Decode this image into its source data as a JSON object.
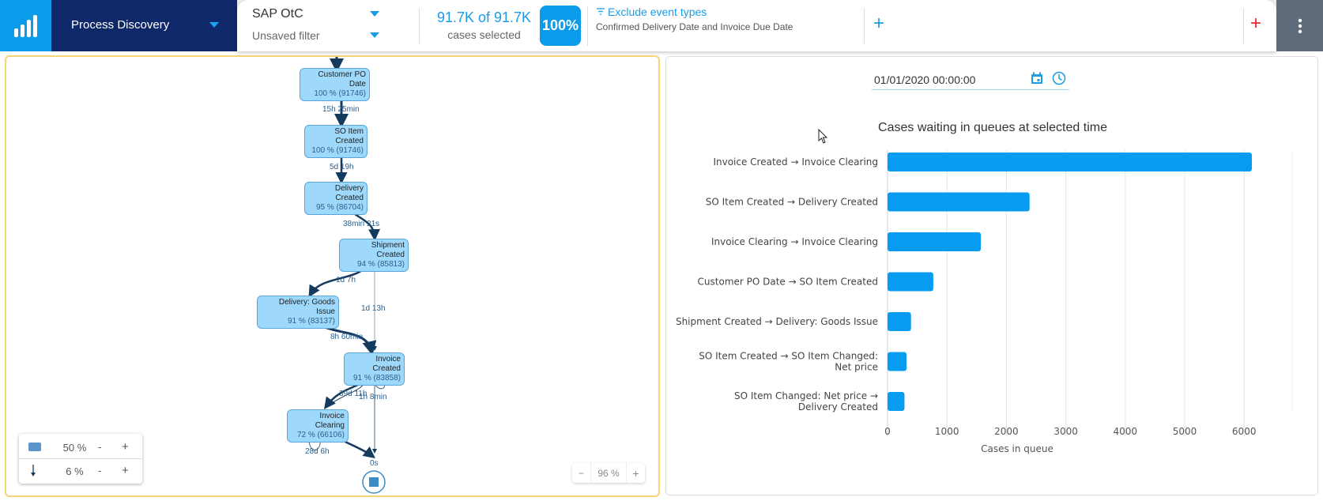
{
  "header": {
    "app_title": "Process Discovery",
    "dataset": "SAP OtC",
    "filter": "Unsaved filter",
    "cases_count": "91.7K of 91.7K",
    "cases_label": "cases selected",
    "cases_pct": "100%",
    "exclude_title": "Exclude event types",
    "exclude_desc": "Confirmed Delivery Date and Invoice Due Date",
    "add_filter": "+",
    "add_filter_red": "+",
    "menu_icon": "kebab-menu-icon"
  },
  "process_map": {
    "nodes": [
      {
        "name": "Customer PO Date",
        "stat": "100 % (91746)"
      },
      {
        "name": "SO Item Created",
        "stat": "100 % (91746)"
      },
      {
        "name": "Delivery Created",
        "stat": "95 % (86704)"
      },
      {
        "name": "Shipment Created",
        "stat": "94 % (85813)"
      },
      {
        "name": "Delivery: Goods Issue",
        "stat": "91 % (83137)"
      },
      {
        "name": "Invoice Created",
        "stat": "91 % (83858)"
      },
      {
        "name": "Invoice Clearing",
        "stat": "72 % (66106)"
      }
    ],
    "edges": [
      {
        "label": "15h 25min"
      },
      {
        "label": "5d 19h"
      },
      {
        "label": "38min 21s"
      },
      {
        "label": "1d 7h"
      },
      {
        "label": "1d 13h"
      },
      {
        "label": "8h 60min"
      },
      {
        "label": "39d 11h"
      },
      {
        "label": "1h 8min"
      },
      {
        "label": "28d 6h"
      },
      {
        "label": "0s"
      }
    ],
    "legend": {
      "activities_pct": "50 %",
      "paths_pct": "6 %",
      "minus": "-",
      "plus": "+"
    },
    "zoom": {
      "minus": "−",
      "level": "96 %",
      "plus": "+"
    }
  },
  "queue_panel": {
    "date_value": "01/01/2020 00:00:00",
    "calendar_icon": "calendar-icon",
    "clock_icon": "clock-icon"
  },
  "chart_data": {
    "type": "bar",
    "orientation": "horizontal",
    "title": "Cases waiting in queues at selected time",
    "xlabel": "Cases in queue",
    "ylabel": "",
    "categories": [
      "Invoice Created → Invoice Clearing",
      "SO Item Created → Delivery Created",
      "Invoice Clearing → Invoice Clearing",
      "Customer PO Date → SO Item Created",
      "Shipment Created → Delivery: Goods Issue",
      "SO Item Created → SO Item Changed: Net price",
      "SO Item Changed: Net price → Delivery Created"
    ],
    "values": [
      6130,
      2390,
      1570,
      770,
      395,
      320,
      285
    ],
    "xlim": [
      0,
      6500
    ],
    "xticks": [
      0,
      1000,
      2000,
      3000,
      4000,
      5000,
      6000
    ],
    "grid": true,
    "bar_color": "#089cf0"
  }
}
